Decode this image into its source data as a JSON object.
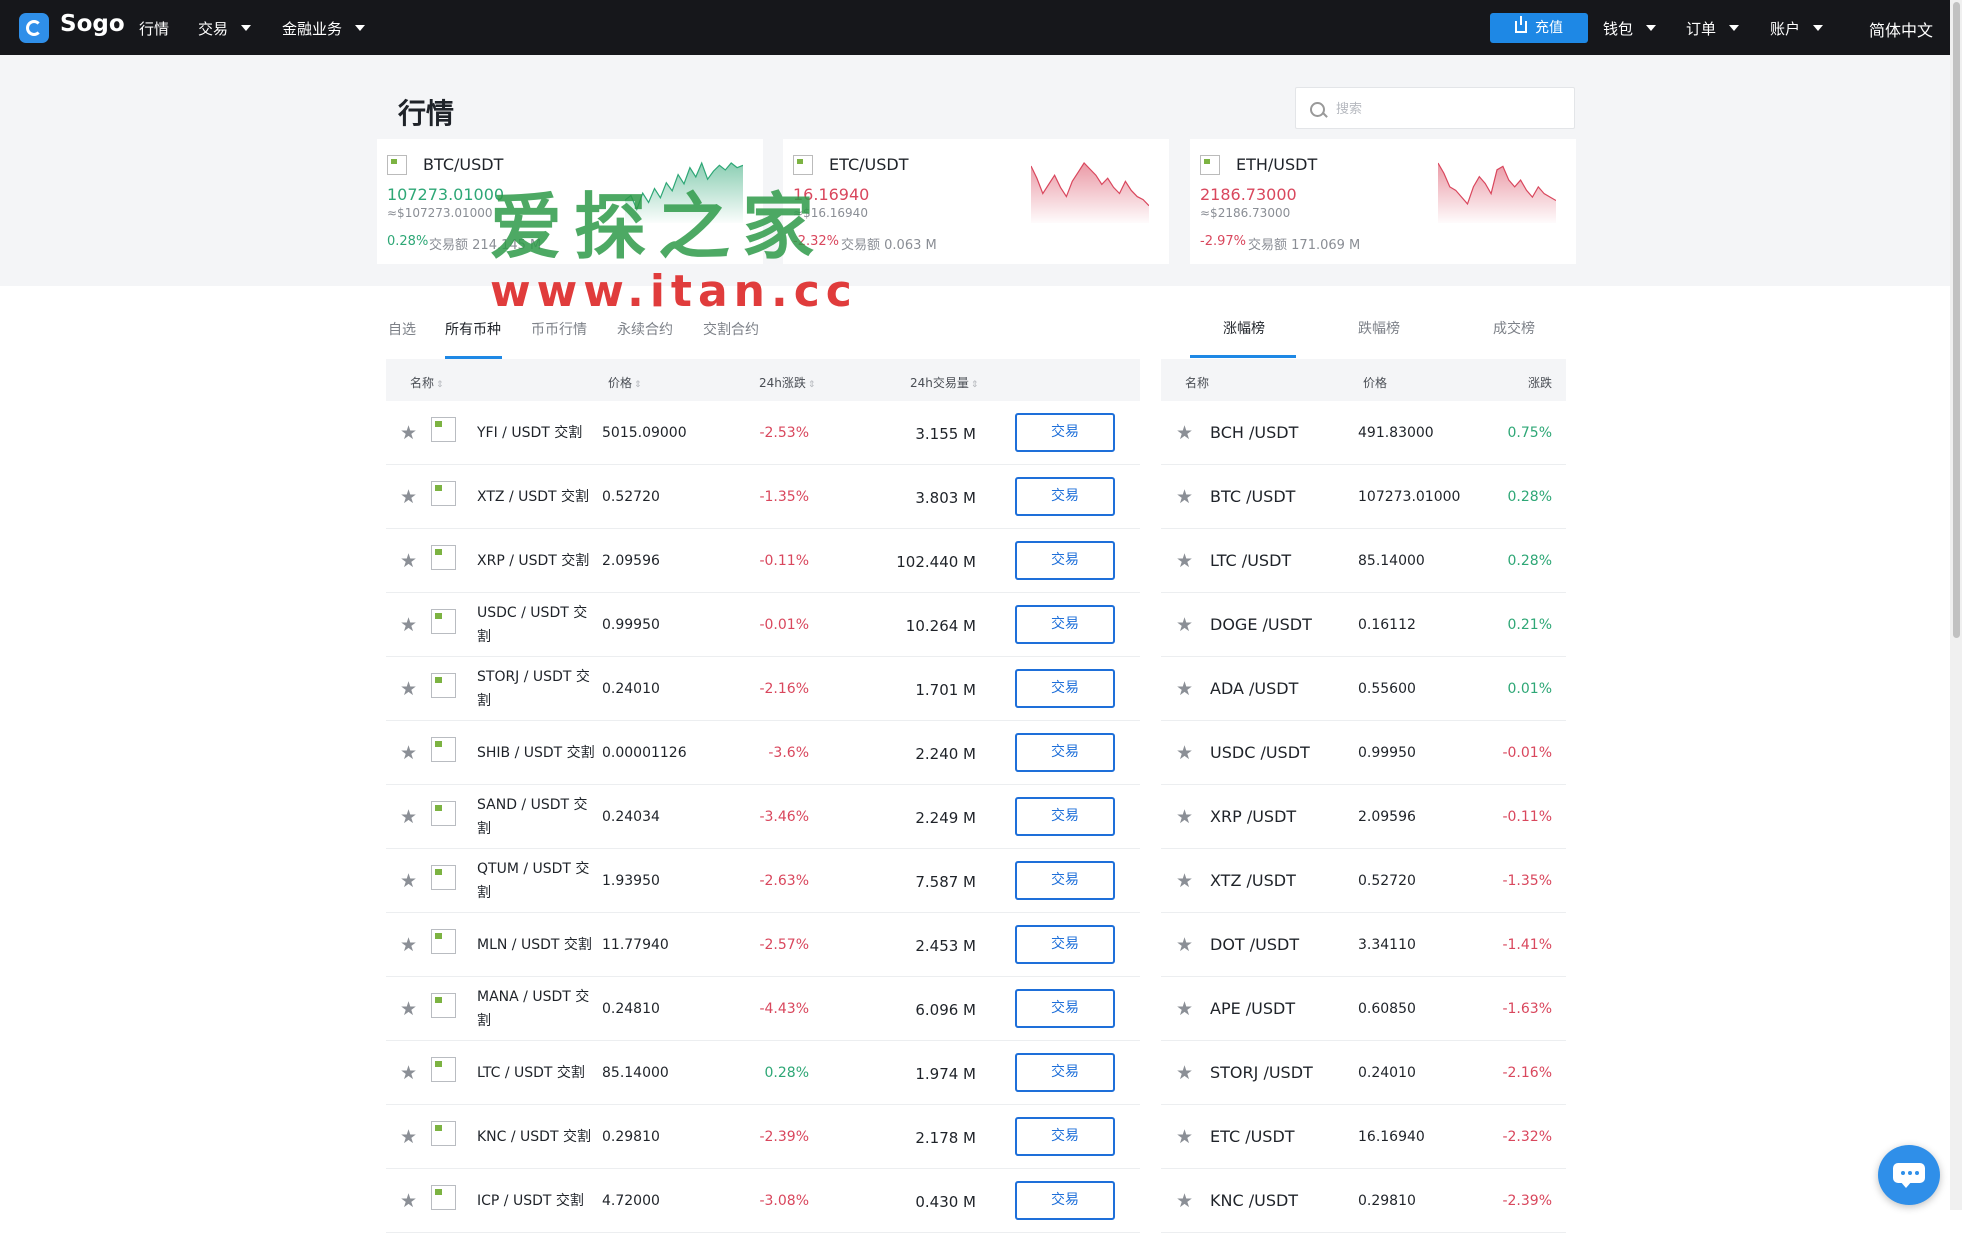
{
  "nav": {
    "brand": "Sogo",
    "items": [
      {
        "label": "行情",
        "dropdown": false
      },
      {
        "label": "交易",
        "dropdown": true
      },
      {
        "label": "金融业务",
        "dropdown": true
      }
    ],
    "deposit": "充值",
    "right_items": [
      {
        "label": "钱包",
        "dropdown": true
      },
      {
        "label": "订单",
        "dropdown": true
      },
      {
        "label": "账户",
        "dropdown": true
      }
    ],
    "language": "简体中文"
  },
  "page_title": "行情",
  "search": {
    "placeholder": "搜索"
  },
  "cards": [
    {
      "pair": "BTC/USDT",
      "price": "107273.01000",
      "fiat": "≈$107273.01000",
      "change": "0.28%",
      "volume_label": "交易额",
      "volume": "214.145 M",
      "trend": "up",
      "spark": [
        30,
        34,
        22,
        36,
        28,
        40,
        32,
        45,
        38,
        52,
        44,
        58,
        50,
        62,
        48,
        55,
        60,
        56,
        62,
        58,
        60
      ]
    },
    {
      "pair": "ETC/USDT",
      "price": "16.16940",
      "fiat": "≈$16.16940",
      "change": "-2.32%",
      "volume_label": "交易额",
      "volume": "0.063 M",
      "trend": "down",
      "spark": [
        58,
        50,
        40,
        46,
        52,
        44,
        38,
        48,
        54,
        60,
        56,
        52,
        46,
        50,
        44,
        40,
        48,
        42,
        38,
        36,
        32
      ]
    },
    {
      "pair": "ETH/USDT",
      "price": "2186.73000",
      "fiat": "≈$2186.73000",
      "change": "-2.97%",
      "volume_label": "交易额",
      "volume": "171.069 M",
      "trend": "down",
      "spark": [
        60,
        54,
        46,
        44,
        40,
        36,
        46,
        52,
        48,
        42,
        56,
        58,
        50,
        46,
        50,
        44,
        40,
        46,
        42,
        40,
        38
      ]
    }
  ],
  "watermark": {
    "cn": "爱探之家",
    "url": "www.itan.cc"
  },
  "tabs": [
    "自选",
    "所有币种",
    "币币行情",
    "永续合约",
    "交割合约"
  ],
  "table": {
    "headers": {
      "name": "名称",
      "price": "价格",
      "change": "24h涨跌",
      "volume": "24h交易量"
    },
    "trade_label": "交易",
    "rows": [
      {
        "pair": "YFI / USDT 交割",
        "price": "5015.09000",
        "change": "-2.53%",
        "volume": "3.155 M",
        "trend": "down"
      },
      {
        "pair": "XTZ / USDT 交割",
        "price": "0.52720",
        "change": "-1.35%",
        "volume": "3.803 M",
        "trend": "down"
      },
      {
        "pair": "XRP / USDT 交割",
        "price": "2.09596",
        "change": "-0.11%",
        "volume": "102.440 M",
        "trend": "down"
      },
      {
        "pair": "USDC / USDT 交割",
        "price": "0.99950",
        "change": "-0.01%",
        "volume": "10.264 M",
        "trend": "down"
      },
      {
        "pair": "STORJ / USDT 交割",
        "price": "0.24010",
        "change": "-2.16%",
        "volume": "1.701 M",
        "trend": "down"
      },
      {
        "pair": "SHIB / USDT 交割",
        "price": "0.00001126",
        "change": "-3.6%",
        "volume": "2.240 M",
        "trend": "down"
      },
      {
        "pair": "SAND / USDT 交割",
        "price": "0.24034",
        "change": "-3.46%",
        "volume": "2.249 M",
        "trend": "down"
      },
      {
        "pair": "QTUM / USDT 交割",
        "price": "1.93950",
        "change": "-2.63%",
        "volume": "7.587 M",
        "trend": "down"
      },
      {
        "pair": "MLN / USDT 交割",
        "price": "11.77940",
        "change": "-2.57%",
        "volume": "2.453 M",
        "trend": "down"
      },
      {
        "pair": "MANA / USDT 交割",
        "price": "0.24810",
        "change": "-4.43%",
        "volume": "6.096 M",
        "trend": "down"
      },
      {
        "pair": "LTC / USDT 交割",
        "price": "85.14000",
        "change": "0.28%",
        "volume": "1.974 M",
        "trend": "up"
      },
      {
        "pair": "KNC / USDT 交割",
        "price": "0.29810",
        "change": "-2.39%",
        "volume": "2.178 M",
        "trend": "down"
      },
      {
        "pair": "ICP / USDT 交割",
        "price": "4.72000",
        "change": "-3.08%",
        "volume": "0.430 M",
        "trend": "down"
      }
    ]
  },
  "ranking": {
    "tabs": [
      "涨幅榜",
      "跌幅榜",
      "成交榜"
    ],
    "headers": {
      "name": "名称",
      "price": "价格",
      "change": "涨跌"
    },
    "rows": [
      {
        "pair": "BCH /USDT",
        "price": "491.83000",
        "change": "0.75%",
        "trend": "up"
      },
      {
        "pair": "BTC /USDT",
        "price": "107273.01000",
        "change": "0.28%",
        "trend": "up"
      },
      {
        "pair": "LTC /USDT",
        "price": "85.14000",
        "change": "0.28%",
        "trend": "up"
      },
      {
        "pair": "DOGE /USDT",
        "price": "0.16112",
        "change": "0.21%",
        "trend": "up"
      },
      {
        "pair": "ADA /USDT",
        "price": "0.55600",
        "change": "0.01%",
        "trend": "up"
      },
      {
        "pair": "USDC /USDT",
        "price": "0.99950",
        "change": "-0.01%",
        "trend": "down"
      },
      {
        "pair": "XRP /USDT",
        "price": "2.09596",
        "change": "-0.11%",
        "trend": "down"
      },
      {
        "pair": "XTZ /USDT",
        "price": "0.52720",
        "change": "-1.35%",
        "trend": "down"
      },
      {
        "pair": "DOT /USDT",
        "price": "3.34110",
        "change": "-1.41%",
        "trend": "down"
      },
      {
        "pair": "APE /USDT",
        "price": "0.60850",
        "change": "-1.63%",
        "trend": "down"
      },
      {
        "pair": "STORJ /USDT",
        "price": "0.24010",
        "change": "-2.16%",
        "trend": "down"
      },
      {
        "pair": "ETC /USDT",
        "price": "16.16940",
        "change": "-2.32%",
        "trend": "down"
      },
      {
        "pair": "KNC /USDT",
        "price": "0.29810",
        "change": "-2.39%",
        "trend": "down"
      }
    ]
  },
  "colors": {
    "up": "#2ea776",
    "down": "#d9475d",
    "accent": "#1e88e5",
    "nav_bg": "#16171b"
  }
}
